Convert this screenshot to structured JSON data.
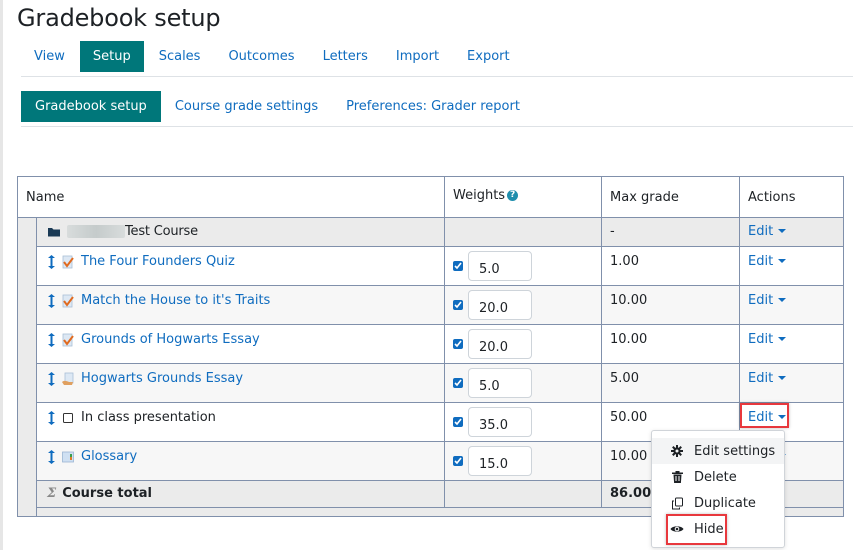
{
  "page": {
    "title": "Gradebook setup"
  },
  "tabs": [
    {
      "label": "View",
      "active": false
    },
    {
      "label": "Setup",
      "active": true
    },
    {
      "label": "Scales",
      "active": false
    },
    {
      "label": "Outcomes",
      "active": false
    },
    {
      "label": "Letters",
      "active": false
    },
    {
      "label": "Import",
      "active": false
    },
    {
      "label": "Export",
      "active": false
    }
  ],
  "subtabs": [
    {
      "label": "Gradebook setup",
      "active": true
    },
    {
      "label": "Course grade settings",
      "active": false
    },
    {
      "label": "Preferences: Grader report",
      "active": false
    }
  ],
  "table": {
    "headers": {
      "name": "Name",
      "weights": "Weights",
      "max_grade": "Max grade",
      "actions": "Actions"
    },
    "category": {
      "name": "Test Course",
      "max_grade": "-",
      "action": "Edit",
      "icon": "folder-icon"
    },
    "items": [
      {
        "name": "The Four Founders Quiz",
        "icon": "quiz-icon",
        "is_link": true,
        "weight_checked": true,
        "weight": "5.0",
        "max_grade": "1.00",
        "action": "Edit"
      },
      {
        "name": "Match the House to it's Traits",
        "icon": "quiz-icon",
        "is_link": true,
        "weight_checked": true,
        "weight": "20.0",
        "max_grade": "10.00",
        "action": "Edit"
      },
      {
        "name": "Grounds of Hogwarts Essay",
        "icon": "quiz-icon",
        "is_link": true,
        "weight_checked": true,
        "weight": "20.0",
        "max_grade": "10.00",
        "action": "Edit"
      },
      {
        "name": "Hogwarts Grounds Essay",
        "icon": "assignment-icon",
        "is_link": true,
        "weight_checked": true,
        "weight": "5.0",
        "max_grade": "5.00",
        "action": "Edit"
      },
      {
        "name": "In class presentation",
        "icon": "manual-item-icon",
        "is_link": false,
        "weight_checked": true,
        "weight": "35.0",
        "max_grade": "50.00",
        "action": "Edit"
      },
      {
        "name": "Glossary",
        "icon": "glossary-icon",
        "is_link": true,
        "weight_checked": true,
        "weight": "15.0",
        "max_grade": "10.00",
        "action": "Edit"
      }
    ],
    "total": {
      "name": "Course total",
      "max_grade": "86.00",
      "icon": "sigma-icon"
    }
  },
  "dropdown": {
    "items": [
      {
        "label": "Edit settings",
        "icon": "gear-icon"
      },
      {
        "label": "Delete",
        "icon": "trash-icon"
      },
      {
        "label": "Duplicate",
        "icon": "copy-icon"
      },
      {
        "label": "Hide",
        "icon": "eye-icon"
      }
    ]
  },
  "colors": {
    "accent": "#00777a",
    "link": "#0f6cbf",
    "highlight": "#e8383d",
    "border": "#8090ab"
  }
}
